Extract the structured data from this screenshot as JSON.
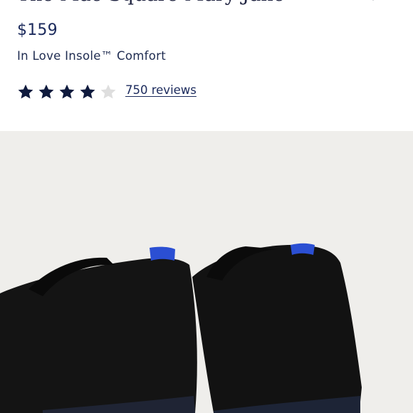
{
  "product": {
    "title": "The Mae Square Mary Jane",
    "price": "$159",
    "feature": "In Love Insole™ Comfort"
  },
  "rating": {
    "value": 4,
    "max": 5,
    "reviews_label": "750 reviews"
  },
  "icons": {
    "star": "star-icon",
    "chevron": "chevron-down-icon"
  },
  "colors": {
    "star_filled": "#0f1a3d",
    "star_empty": "#dedede",
    "text": "#1b2a5c",
    "image_bg": "#efeeeb",
    "heel_tab": "#2b4fd3",
    "shoe": "#141414"
  }
}
